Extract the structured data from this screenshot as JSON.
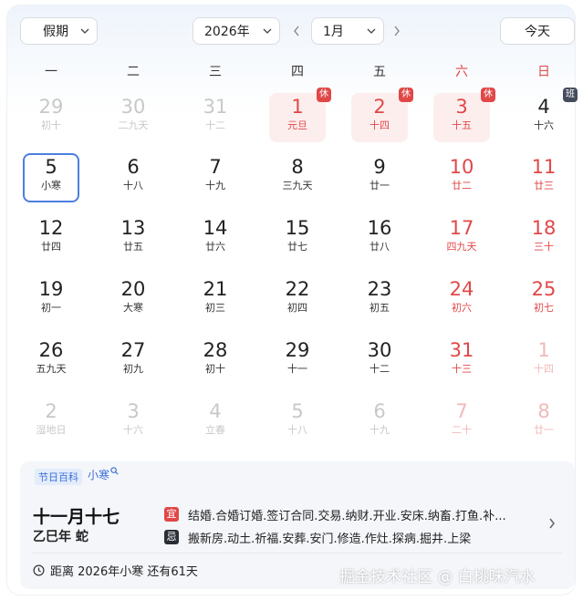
{
  "toolbar": {
    "holiday_select": "假期",
    "year_select": "2026年",
    "month_select": "1月",
    "today_button": "今天"
  },
  "weekdays": [
    "一",
    "二",
    "三",
    "四",
    "五",
    "六",
    "日"
  ],
  "weekday_weekend_color": "#e04848",
  "weeks": [
    [
      {
        "d": "29",
        "l": "初十",
        "faded": true
      },
      {
        "d": "30",
        "l": "二九天",
        "faded": true
      },
      {
        "d": "31",
        "l": "十二",
        "faded": true
      },
      {
        "d": "1",
        "l": "元旦",
        "holiday": true,
        "badge": "休"
      },
      {
        "d": "2",
        "l": "十四",
        "holiday": true,
        "badge": "休"
      },
      {
        "d": "3",
        "l": "十五",
        "holiday": true,
        "badge": "休"
      },
      {
        "d": "4",
        "l": "十六",
        "badge": "班",
        "work": true
      }
    ],
    [
      {
        "d": "5",
        "l": "小寒",
        "today": true
      },
      {
        "d": "6",
        "l": "十八"
      },
      {
        "d": "7",
        "l": "十九"
      },
      {
        "d": "8",
        "l": "三九天"
      },
      {
        "d": "9",
        "l": "廿一"
      },
      {
        "d": "10",
        "l": "廿二",
        "red": true
      },
      {
        "d": "11",
        "l": "廿三",
        "red": true
      }
    ],
    [
      {
        "d": "12",
        "l": "廿四"
      },
      {
        "d": "13",
        "l": "廿五"
      },
      {
        "d": "14",
        "l": "廿六"
      },
      {
        "d": "15",
        "l": "廿七"
      },
      {
        "d": "16",
        "l": "廿八"
      },
      {
        "d": "17",
        "l": "四九天",
        "red": true
      },
      {
        "d": "18",
        "l": "三十",
        "red": true
      }
    ],
    [
      {
        "d": "19",
        "l": "初一"
      },
      {
        "d": "20",
        "l": "大寒"
      },
      {
        "d": "21",
        "l": "初三"
      },
      {
        "d": "22",
        "l": "初四"
      },
      {
        "d": "23",
        "l": "初五"
      },
      {
        "d": "24",
        "l": "初六",
        "red": true
      },
      {
        "d": "25",
        "l": "初七",
        "red": true
      }
    ],
    [
      {
        "d": "26",
        "l": "五九天"
      },
      {
        "d": "27",
        "l": "初九"
      },
      {
        "d": "28",
        "l": "初十"
      },
      {
        "d": "29",
        "l": "十一"
      },
      {
        "d": "30",
        "l": "十二"
      },
      {
        "d": "31",
        "l": "十三",
        "red": true
      },
      {
        "d": "1",
        "l": "十四",
        "faded": true,
        "red": true
      }
    ],
    [
      {
        "d": "2",
        "l": "湿地日",
        "faded": true
      },
      {
        "d": "3",
        "l": "十六",
        "faded": true
      },
      {
        "d": "4",
        "l": "立春",
        "faded": true
      },
      {
        "d": "5",
        "l": "十八",
        "faded": true
      },
      {
        "d": "6",
        "l": "十九",
        "faded": true
      },
      {
        "d": "7",
        "l": "二十",
        "faded": true,
        "red": true
      },
      {
        "d": "8",
        "l": "廿一",
        "faded": true,
        "red": true
      }
    ]
  ],
  "info": {
    "baike_tag": "节日百科",
    "term_link": "小寒",
    "lunar_date": "十一月十七",
    "ganzhi": "乙巳年 蛇",
    "yi_label": "宜",
    "yi_text": "结婚.合婚订婚.签订合同.交易.纳财.开业.安床.纳畜.打鱼.补...",
    "ji_label": "忌",
    "ji_text": "搬新房.动土.祈福.安葬.安门.修造.作灶.探病.掘井.上梁",
    "countdown": "距离 2026年小寒 还有61天"
  },
  "watermark": "掘金技术社区 @ 白桃味汽水"
}
